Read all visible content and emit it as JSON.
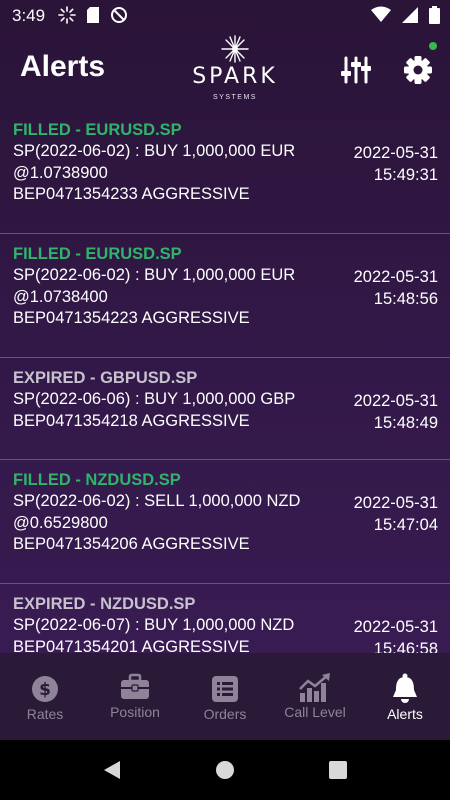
{
  "status_bar": {
    "time": "3:49"
  },
  "header": {
    "title": "Alerts",
    "logo_word": "SPARK",
    "logo_sub": "SYSTEMS"
  },
  "alerts": [
    {
      "status": "FILLED - EURUSD.SP",
      "status_type": "filled",
      "lines": [
        "SP(2022-06-02) : BUY 1,000,000 EUR",
        "@1.0738900",
        "BEP0471354233 AGGRESSIVE"
      ],
      "date": "2022-05-31",
      "time": "15:49:31"
    },
    {
      "status": "FILLED - EURUSD.SP",
      "status_type": "filled",
      "lines": [
        "SP(2022-06-02) : BUY 1,000,000 EUR",
        "@1.0738400",
        "BEP0471354223 AGGRESSIVE"
      ],
      "date": "2022-05-31",
      "time": "15:48:56"
    },
    {
      "status": "EXPIRED - GBPUSD.SP",
      "status_type": "expired",
      "lines": [
        "SP(2022-06-06) : BUY 1,000,000 GBP",
        "BEP0471354218 AGGRESSIVE"
      ],
      "date": "2022-05-31",
      "time": "15:48:49"
    },
    {
      "status": "FILLED - NZDUSD.SP",
      "status_type": "filled",
      "lines": [
        "SP(2022-06-02) : SELL 1,000,000 NZD",
        "@0.6529800",
        "BEP0471354206 AGGRESSIVE"
      ],
      "date": "2022-05-31",
      "time": "15:47:04"
    },
    {
      "status": "EXPIRED - NZDUSD.SP",
      "status_type": "expired",
      "lines": [
        "SP(2022-06-07) : BUY 1,000,000 NZD",
        "BEP0471354201 AGGRESSIVE"
      ],
      "date": "2022-05-31",
      "time": "15:46:58"
    }
  ],
  "nav": {
    "rates": "Rates",
    "position": "Position",
    "orders": "Orders",
    "call_level": "Call Level",
    "alerts": "Alerts"
  },
  "colors": {
    "filled": "#2fb46a",
    "expired": "#c8c2cf",
    "online": "#36b84a"
  }
}
